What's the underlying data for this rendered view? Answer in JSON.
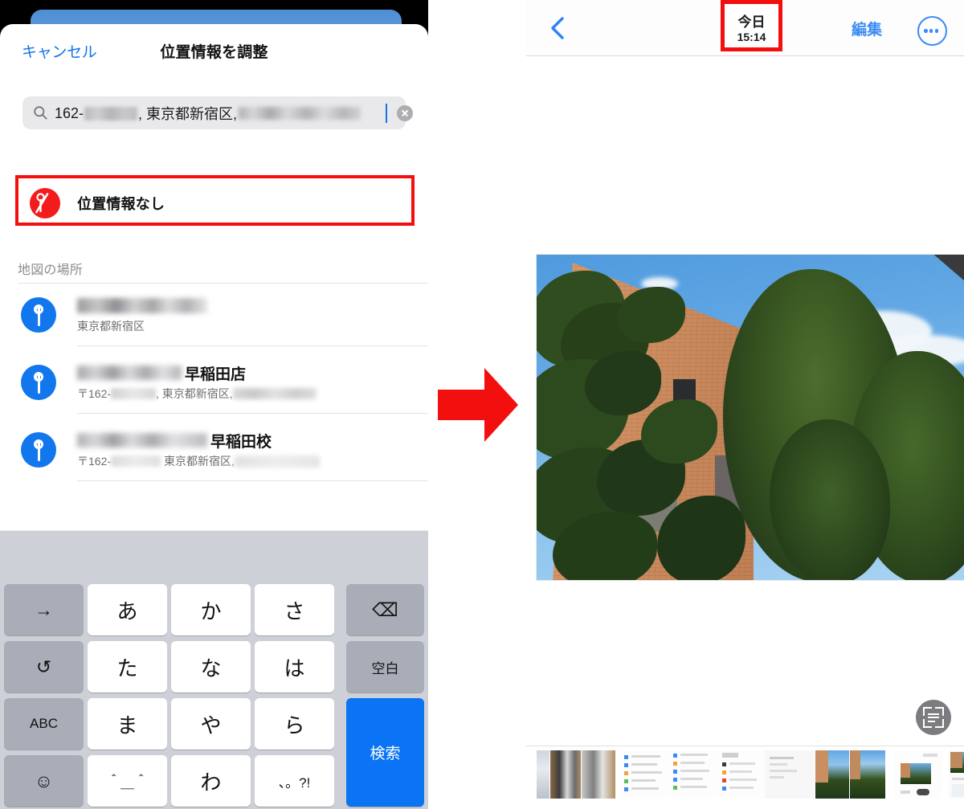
{
  "left_panel": {
    "sheet": {
      "cancel_label": "キャンセル",
      "title": "位置情報を調整"
    },
    "search": {
      "icon": "search-icon",
      "value_prefix": "162-",
      "value_mid": ", 東京都新宿区, ",
      "redacted_1": "[redacted]",
      "redacted_2": "[redacted]",
      "clear_icon": "clear-circle-icon",
      "caret_visible": true
    },
    "no_location_row": {
      "icon": "location-slash-icon",
      "label": "位置情報なし",
      "highlight_color": "#f40f0f"
    },
    "section_header": "地図の場所",
    "map_places": [
      {
        "pin_icon": "map-pin-icon",
        "title_redacted": "[redacted]",
        "title_visible": "",
        "subtitle_prefix": "",
        "subtitle_visible": "東京都新宿区",
        "subtitle_redacted": ""
      },
      {
        "pin_icon": "map-pin-icon",
        "title_redacted": "[redacted]",
        "title_visible": "早稲田店",
        "subtitle_prefix": "〒162-",
        "subtitle_visible": ", 東京都新宿区, ",
        "subtitle_redacted": "[redacted]"
      },
      {
        "pin_icon": "map-pin-icon",
        "title_redacted": "[redacted]",
        "title_visible": "早稲田校",
        "subtitle_prefix": "〒162-",
        "subtitle_visible": "東京都新宿区, ",
        "subtitle_redacted": "[redacted]"
      }
    ],
    "keyboard": {
      "rows": [
        [
          {
            "label": "→",
            "name": "key-arrow-right",
            "style": "gray"
          },
          {
            "label": "あ",
            "name": "key-a",
            "style": "white"
          },
          {
            "label": "か",
            "name": "key-ka",
            "style": "white"
          },
          {
            "label": "さ",
            "name": "key-sa",
            "style": "white"
          },
          {
            "label": "⌫",
            "name": "key-backspace",
            "style": "gray"
          }
        ],
        [
          {
            "label": "↺",
            "name": "key-undo",
            "style": "gray"
          },
          {
            "label": "た",
            "name": "key-ta",
            "style": "white"
          },
          {
            "label": "な",
            "name": "key-na",
            "style": "white"
          },
          {
            "label": "は",
            "name": "key-ha",
            "style": "white"
          },
          {
            "label": "空白",
            "name": "key-space",
            "style": "gray"
          }
        ],
        [
          {
            "label": "ABC",
            "name": "key-abc",
            "style": "gray"
          },
          {
            "label": "ま",
            "name": "key-ma",
            "style": "white"
          },
          {
            "label": "や",
            "name": "key-ya",
            "style": "white"
          },
          {
            "label": "ら",
            "name": "key-ra",
            "style": "white"
          },
          {
            "label": "検索",
            "name": "key-search",
            "style": "blue"
          }
        ],
        [
          {
            "label": "☺",
            "name": "key-emoji",
            "style": "gray"
          },
          {
            "label": "＾＿＾",
            "name": "key-kaomoji",
            "style": "white"
          },
          {
            "label": "わ",
            "name": "key-wa",
            "style": "white"
          },
          {
            "label": "、。?!",
            "name": "key-punctuation",
            "style": "white"
          }
        ]
      ]
    }
  },
  "arrow": {
    "name": "red-right-arrow",
    "color": "#f40f0f"
  },
  "right_panel": {
    "nav": {
      "back_icon": "chevron-left-icon",
      "date_day": "今日",
      "date_time": "15:14",
      "date_highlight_color": "#f40f0f",
      "edit_label": "編集",
      "more_icon": "ellipsis-circle-icon"
    },
    "photo": {
      "name": "main-photo",
      "description": "brick building with green tree foliage against blue sky"
    },
    "live_text_button": {
      "icon": "live-text-scan-icon"
    },
    "thumbnails": [
      {
        "kind": "photo-dark"
      },
      {
        "kind": "photo-bw"
      },
      {
        "kind": "screenshot-list"
      },
      {
        "kind": "screenshot-list"
      },
      {
        "kind": "screenshot-list"
      },
      {
        "kind": "screenshot-doc"
      },
      {
        "kind": "photo-tree"
      },
      {
        "kind": "photo-tree"
      },
      {
        "kind": "screenshot-map"
      },
      {
        "kind": "screenshot-photo"
      },
      {
        "kind": "screenshot-settings"
      },
      {
        "kind": "screenshot-settings"
      }
    ]
  }
}
